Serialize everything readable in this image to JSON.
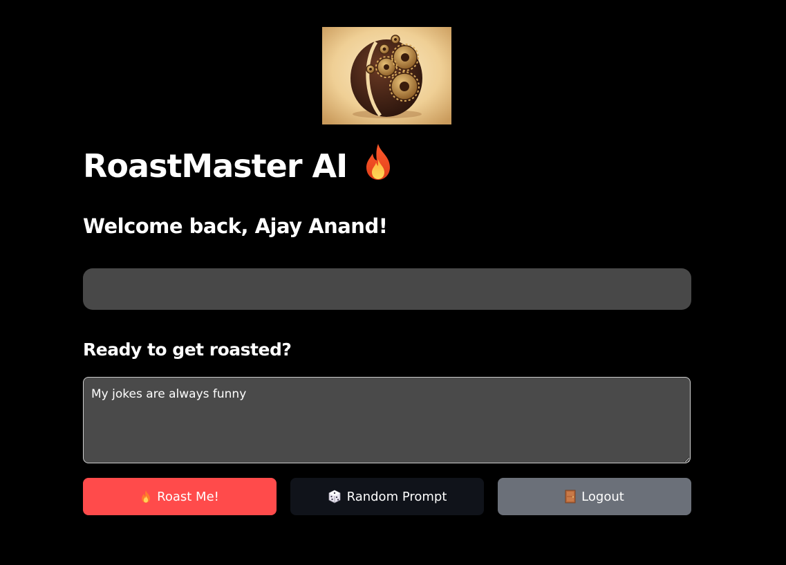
{
  "header": {
    "title": "RoastMaster AI",
    "title_icon": "fire-icon",
    "logo_icon": "coffee-bean-gears-logo"
  },
  "welcome_text": "Welcome back, Ajay Anand!",
  "prompt_section": {
    "heading": "Ready to get roasted?",
    "input_value": "My jokes are always funny"
  },
  "buttons": {
    "roast_label": "Roast Me!",
    "roast_icon": "fire-icon",
    "random_label": "Random Prompt",
    "random_icon": "dice-icon",
    "logout_label": "Logout",
    "logout_icon": "door-icon"
  },
  "colors": {
    "background": "#000000",
    "primary_button": "#ff4b4b",
    "secondary_button": "#10131a",
    "logout_button": "#6b7079",
    "input_background": "#4a4a4a"
  }
}
